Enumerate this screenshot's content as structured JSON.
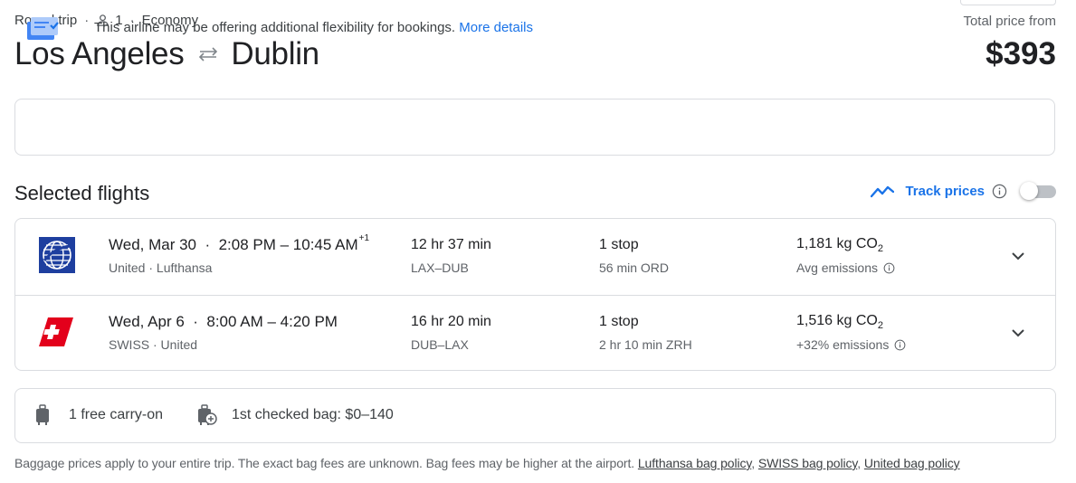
{
  "header": {
    "trip_type": "Round trip",
    "passengers": "1",
    "cabin": "Economy",
    "origin": "Los Angeles",
    "destination": "Dublin",
    "total_label": "Total price from",
    "total_price": "$393"
  },
  "info": {
    "text": "This airline may be offering additional flexibility for bookings.",
    "link": "More details"
  },
  "selected": {
    "title": "Selected flights",
    "track_label": "Track prices",
    "track_enabled": false
  },
  "flights": [
    {
      "date": "Wed, Mar 30",
      "times": "2:08 PM – 10:45 AM",
      "day_offset": "+1",
      "airlines": "United · Lufthansa",
      "duration": "12 hr 37 min",
      "airports": "LAX–DUB",
      "stops": "1 stop",
      "layover": "56 min ORD",
      "emissions_value": "1,181 kg CO",
      "emissions_sub": "2",
      "emissions_note": "Avg emissions",
      "logo": "united-globe-logo"
    },
    {
      "date": "Wed, Apr 6",
      "times": "8:00 AM – 4:20 PM",
      "day_offset": "",
      "airlines": "SWISS · United",
      "duration": "16 hr 20 min",
      "airports": "DUB–LAX",
      "stops": "1 stop",
      "layover": "2 hr 10 min ZRH",
      "emissions_value": "1,516 kg CO",
      "emissions_sub": "2",
      "emissions_note": "+32% emissions",
      "logo": "swiss-cross-logo"
    }
  ],
  "baggage": {
    "carry_on": "1 free carry-on",
    "checked": "1st checked bag: $0–140"
  },
  "footnote": {
    "text": "Baggage prices apply to your entire trip. The exact bag fees are unknown. Bag fees may be higher at the airport.",
    "links": [
      "Lufthansa bag policy",
      "SWISS bag policy",
      "United bag policy"
    ]
  },
  "colors": {
    "accent": "#1a73e8",
    "border": "#dadce0",
    "swiss_red": "#e3001b",
    "united_blue": "#1e3f9f"
  }
}
